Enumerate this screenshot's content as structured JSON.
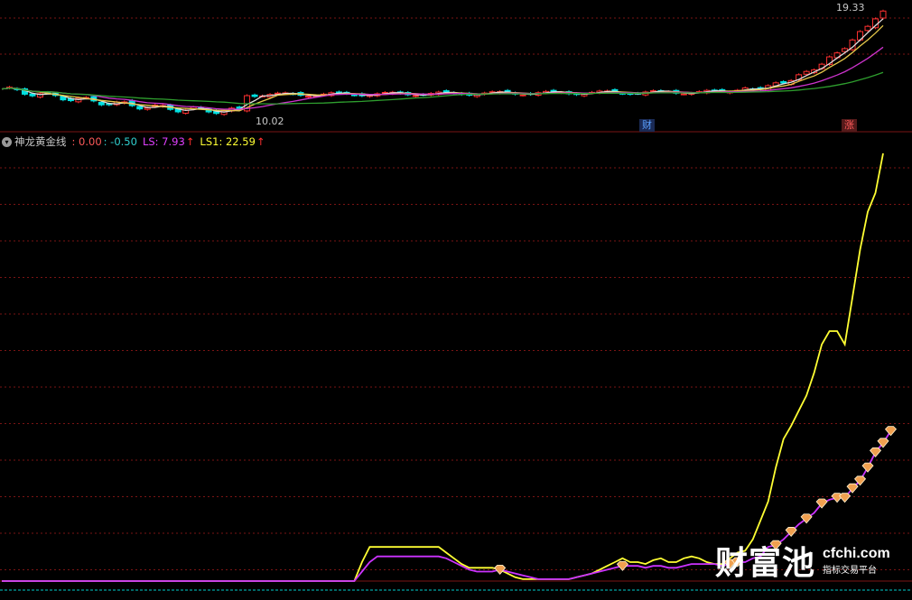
{
  "price_panel": {
    "high_label": "19.33",
    "low_label": "10.02",
    "badge_cai": "财",
    "badge_zhang": "涨"
  },
  "indicator": {
    "toggle_symbol": "▾",
    "name": "神龙黄金线",
    "v1": ": 0.00",
    "v2": ": -0.50",
    "ls_label": "LS: 7.93",
    "ls_arrow": "↑",
    "ls1_label": "LS1: 22.59",
    "ls1_arrow": "↑"
  },
  "watermark": {
    "cn": "财富池",
    "en": "cfchi.com",
    "sub": "指标交易平台"
  },
  "colors": {
    "background": "#000000",
    "up": "#ff3030",
    "down": "#00e0e0",
    "grid": "#7a1414",
    "ma_white": "#dddddd",
    "ma_yellow": "#e6c84a",
    "ma_magenta": "#cc33cc",
    "ma_green": "#2e9e2e",
    "ls": "#cc33ff",
    "ls1": "#ffff33",
    "zero": "#00cccc",
    "diamond": "#f0a050"
  },
  "chart_data": [
    {
      "type": "candlestick",
      "title": "",
      "annotations": [
        "19.33",
        "10.02"
      ],
      "high": 19.33,
      "low": 10.02
    },
    {
      "type": "line",
      "title": "神龙黄金线",
      "series": [
        {
          "name": "LS",
          "last": 7.93,
          "values": [
            0,
            0,
            0,
            0,
            0,
            0,
            0,
            0,
            0,
            0,
            0,
            0,
            0,
            0,
            0,
            0,
            0,
            0,
            0,
            0,
            0,
            0,
            0,
            0,
            0,
            0,
            0,
            0,
            0,
            0,
            0,
            0,
            0,
            0,
            0,
            0,
            0,
            0,
            0,
            0,
            0,
            0,
            0,
            0,
            0,
            0,
            0,
            0.5,
            1.0,
            1.3,
            1.3,
            1.3,
            1.3,
            1.3,
            1.3,
            1.3,
            1.3,
            1.3,
            1.2,
            1.0,
            0.8,
            0.6,
            0.5,
            0.5,
            0.5,
            0.6,
            0.5,
            0.4,
            0.3,
            0.2,
            0.1,
            0.1,
            0.1,
            0.1,
            0.1,
            0.2,
            0.3,
            0.4,
            0.5,
            0.6,
            0.7,
            0.8,
            0.8,
            0.8,
            0.7,
            0.8,
            0.8,
            0.7,
            0.7,
            0.8,
            0.9,
            0.9,
            0.9,
            0.9,
            0.8,
            0.9,
            1.0,
            1.0,
            1.2,
            1.3,
            1.8,
            1.9,
            2.2,
            2.6,
            3.0,
            3.3,
            3.6,
            4.1,
            4.3,
            4.4,
            4.4,
            4.9,
            5.3,
            6.0,
            6.8,
            7.3,
            7.93
          ]
        },
        {
          "name": "LS1",
          "last": 22.59,
          "values": [
            0,
            0,
            0,
            0,
            0,
            0,
            0,
            0,
            0,
            0,
            0,
            0,
            0,
            0,
            0,
            0,
            0,
            0,
            0,
            0,
            0,
            0,
            0,
            0,
            0,
            0,
            0,
            0,
            0,
            0,
            0,
            0,
            0,
            0,
            0,
            0,
            0,
            0,
            0,
            0,
            0,
            0,
            0,
            0,
            0,
            0,
            0,
            1.0,
            1.8,
            1.8,
            1.8,
            1.8,
            1.8,
            1.8,
            1.8,
            1.8,
            1.8,
            1.8,
            1.5,
            1.2,
            0.9,
            0.7,
            0.7,
            0.7,
            0.7,
            0.6,
            0.4,
            0.2,
            0.1,
            0.1,
            0.1,
            0.1,
            0.1,
            0.1,
            0.1,
            0.2,
            0.3,
            0.4,
            0.6,
            0.8,
            1.0,
            1.2,
            1.0,
            1.0,
            0.9,
            1.1,
            1.2,
            1.0,
            1.0,
            1.2,
            1.3,
            1.2,
            1.0,
            0.9,
            0.9,
            1.2,
            1.5,
            1.6,
            2.2,
            3.2,
            4.2,
            6.0,
            7.5,
            8.2,
            9.0,
            9.8,
            11.0,
            12.5,
            13.2,
            13.2,
            12.5,
            15.0,
            17.5,
            19.5,
            20.5,
            22.59
          ]
        },
        {
          "name": "0.00",
          "last": 0.0
        },
        {
          "name": "-0.50",
          "last": -0.5
        }
      ],
      "signals_at_index": [
        65,
        81,
        95,
        96,
        101,
        103,
        105,
        107,
        109,
        110,
        111,
        112,
        113,
        114,
        115,
        116,
        117
      ]
    }
  ]
}
